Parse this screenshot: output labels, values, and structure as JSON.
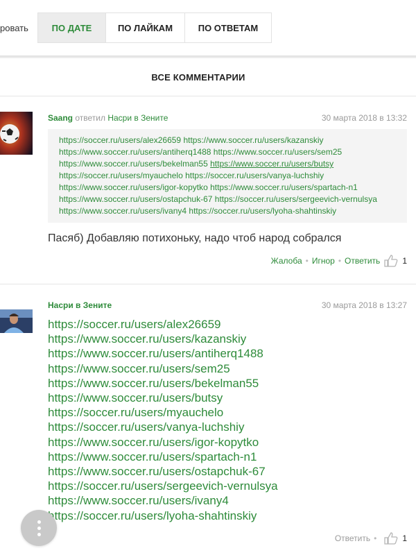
{
  "sort": {
    "partial_label": "ровать",
    "tabs": [
      {
        "label": "ПО ДАТЕ",
        "active": true
      },
      {
        "label": "ПО ЛАЙКАМ",
        "active": false
      },
      {
        "label": "ПО ОТВЕТАМ",
        "active": false
      }
    ]
  },
  "section_title": "ВСЕ КОММЕНТАРИИ",
  "comments": [
    {
      "author": "Saang",
      "replied_word": "ответил",
      "reply_to": "Насри в Зените",
      "date": "30 марта 2018 в 13:32",
      "quote_lines": [
        [
          "https://soccer.ru/users/alex26659",
          " https://www.soccer.ru/users/kazanskiy"
        ],
        [
          "https://www.soccer.ru/users/antiherq1488",
          " https://www.soccer.ru/users/sem25"
        ],
        [
          "https://www.soccer.ru/users/bekelman55",
          " https://www.soccer.ru/users/butsy"
        ],
        [
          "https://soccer.ru/users/myauchelo",
          " https://soccer.ru/users/vanya-luchshiy"
        ],
        [
          "https://www.soccer.ru/users/igor-kopytko",
          " https://www.soccer.ru/users/spartach-n1"
        ],
        [
          "https://www.soccer.ru/users/ostapchuk-67",
          " https://soccer.ru/users/sergeevich-vernulsya"
        ],
        [
          "https://www.soccer.ru/users/ivany4",
          " https://soccer.ru/users/lyoha-shahtinskiy"
        ]
      ],
      "text": "Пасяб) Добавляю потихоньку, надо чтоб народ собрался",
      "actions": {
        "complain": "Жалоба",
        "ignore": "Игнор",
        "reply": "Ответить",
        "likes": "1"
      }
    },
    {
      "author": "Насри в Зените",
      "date": "30 марта 2018 в 13:27",
      "links": [
        "https://soccer.ru/users/alex26659",
        "https://www.soccer.ru/users/kazanskiy",
        "https://www.soccer.ru/users/antiherq1488",
        "https://www.soccer.ru/users/sem25",
        "https://www.soccer.ru/users/bekelman55",
        "https://www.soccer.ru/users/butsy",
        "https://soccer.ru/users/myauchelo",
        "https://soccer.ru/users/vanya-luchshiy",
        "https://www.soccer.ru/users/igor-kopytko",
        "https://www.soccer.ru/users/spartach-n1",
        "https://www.soccer.ru/users/ostapchuk-67",
        "https://soccer.ru/users/sergeevich-vernulsya",
        "https://www.soccer.ru/users/ivany4",
        "https://soccer.ru/users/lyoha-shahtinskiy"
      ],
      "actions": {
        "reply": "Ответить",
        "likes": "1"
      }
    }
  ],
  "colors": {
    "accent": "#2e8b3a",
    "muted": "#9a9a9a",
    "quote_bg": "#f4f4f4"
  },
  "icons": {
    "like": "thumbs-up-icon",
    "menu": "more-vertical-icon"
  }
}
